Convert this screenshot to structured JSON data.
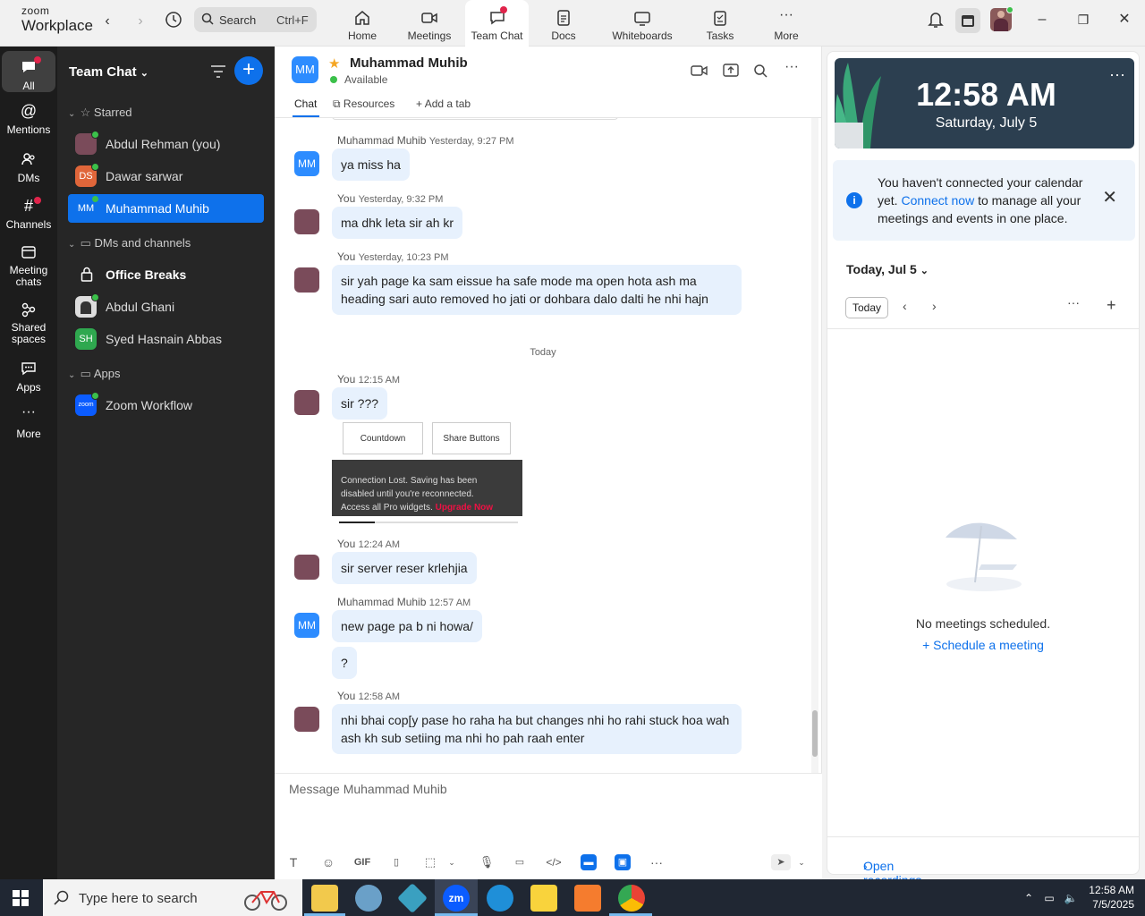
{
  "brand": {
    "top": "zoom",
    "bottom": "Workplace"
  },
  "search": {
    "label": "Search",
    "shortcut": "Ctrl+F"
  },
  "tabs": [
    {
      "label": "Home",
      "icon": "home-icon"
    },
    {
      "label": "Meetings",
      "icon": "video-camera-icon"
    },
    {
      "label": "Team Chat",
      "icon": "chat-icon"
    },
    {
      "label": "Docs",
      "icon": "document-icon"
    },
    {
      "label": "Whiteboards",
      "icon": "whiteboard-icon"
    },
    {
      "label": "Tasks",
      "icon": "clipboard-icon"
    },
    {
      "label": "More",
      "icon": "more-icon"
    }
  ],
  "rail": [
    {
      "label": "All"
    },
    {
      "label": "Mentions"
    },
    {
      "label": "DMs"
    },
    {
      "label": "Channels"
    },
    {
      "label": "Meeting",
      "label2": "chats"
    },
    {
      "label": "Shared",
      "label2": "spaces"
    },
    {
      "label": "Apps"
    },
    {
      "label": "More"
    }
  ],
  "panel": {
    "title": "Team Chat",
    "sections": {
      "starred": "Starred",
      "dms": "DMs and channels",
      "apps": "Apps"
    },
    "starred": [
      {
        "name": "Abdul Rehman (you)",
        "initials": ""
      },
      {
        "name": "Dawar sarwar",
        "initials": "DS"
      },
      {
        "name": "Muhammad Muhib",
        "initials": "MM"
      }
    ],
    "dms": [
      {
        "name": "Office Breaks"
      },
      {
        "name": "Abdul Ghani"
      },
      {
        "name": "Syed Hasnain Abbas",
        "initials": "SH"
      }
    ],
    "apps": [
      {
        "name": "Zoom Workflow",
        "initials": "zoom"
      }
    ]
  },
  "chat": {
    "contact": "Muhammad Muhib",
    "initials": "MM",
    "status": "Available",
    "subtabs": {
      "chat": "Chat",
      "resources": "Resources",
      "add": "Add a tab"
    },
    "today_label": "Today",
    "messages": [
      {
        "sender": "Muhammad Muhib",
        "time": "Yesterday, 9:27 PM",
        "text": "ya miss ha"
      },
      {
        "sender": "You",
        "time": "Yesterday, 9:32 PM",
        "text": "ma dhk leta sir ah kr"
      },
      {
        "sender": "You",
        "time": "Yesterday, 10:23 PM",
        "text": "sir yah page ka sam eissue ha safe mode ma open hota ash ma heading sari auto removed ho jati or dohbara dalo dalti he nhi hajn"
      },
      {
        "sender": "You",
        "time": "12:15 AM",
        "text": "sir ???"
      },
      {
        "sender": "You",
        "time": "12:24 AM",
        "text": "sir server reser krlehjia"
      },
      {
        "sender": "Muhammad Muhib",
        "time": "12:57 AM",
        "text": "new page pa b ni howa/",
        "text2": "?"
      },
      {
        "sender": "You",
        "time": "12:58 AM",
        "text": "nhi bhai cop[y pase ho raha ha but changes nhi ho rahi stuck hoa wah ash kh sub setiing ma nhi ho pah raah enter"
      }
    ],
    "screenshot": {
      "card1": "Countdown",
      "card2": "Share Buttons",
      "line1": "Connection Lost. Saving has been",
      "line2": "disabled until you're reconnected.",
      "line3": "Access all Pro widgets.",
      "upgrade": "Upgrade Now"
    },
    "composer_placeholder": "Message Muhammad Muhib",
    "toolbar_gif": "GIF"
  },
  "right": {
    "time": "12:58 AM",
    "date": "Saturday, July 5",
    "notice_pre": "You haven't connected your calendar yet.",
    "notice_link": "Connect now",
    "notice_post": "to manage all your meetings and events in one place.",
    "day_title": "Today, Jul 5",
    "today_btn": "Today",
    "no_meetings": "No meetings scheduled.",
    "schedule": "Schedule a meeting",
    "recordings": "Open recordings"
  },
  "taskbar": {
    "search": "Type here to search",
    "time": "12:58 AM",
    "date": "7/5/2025"
  },
  "colors": {
    "accent": "#0e71eb",
    "rail": "#1c1c1c",
    "panel": "#262626",
    "bubble": "#e7f1fd",
    "presence": "#3bc04a"
  }
}
